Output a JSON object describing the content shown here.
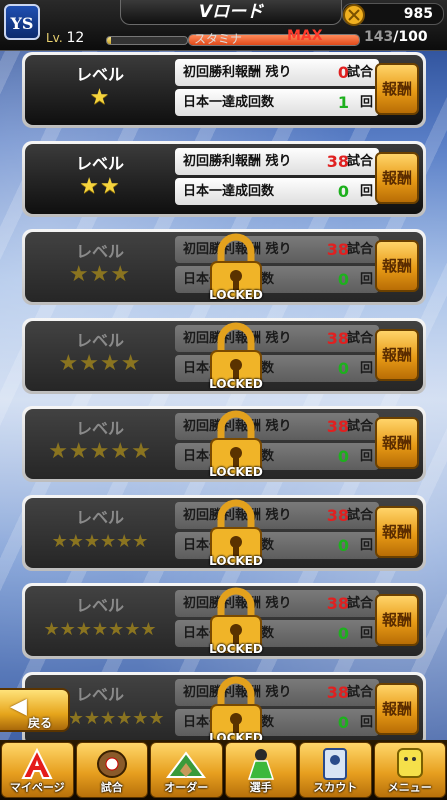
{
  "header": {
    "logo": "YS",
    "title": "Vロード",
    "coins": "985",
    "level_label": "Lv.",
    "level_value": "12",
    "exp_fraction": 0.05,
    "stamina_label": "スタミナ",
    "stamina_max_label": "MAX",
    "stamina_current": "143",
    "stamina_max": "/100",
    "stamina_fraction": 1.0
  },
  "rows": [
    {
      "level_label": "レベル",
      "stars": "★",
      "stars_count": 1,
      "first_win_label": "初回勝利報酬 残り",
      "first_win_value": "0",
      "first_win_unit": "試合",
      "champion_label": "日本一達成回数",
      "champion_value": "1",
      "champion_unit": "回",
      "reward_label": "報酬",
      "locked": false,
      "lock_label": ""
    },
    {
      "level_label": "レベル",
      "stars": "★★",
      "stars_count": 2,
      "first_win_label": "初回勝利報酬 残り",
      "first_win_value": "38",
      "first_win_unit": "試合",
      "champion_label": "日本一達成回数",
      "champion_value": "0",
      "champion_unit": "回",
      "reward_label": "報酬",
      "locked": false,
      "lock_label": ""
    },
    {
      "level_label": "レベル",
      "stars": "★★★",
      "stars_count": 3,
      "first_win_label": "初回勝利報酬 残り",
      "first_win_value": "38",
      "first_win_unit": "試合",
      "champion_label": "日本一達成回数",
      "champion_value": "0",
      "champion_unit": "回",
      "reward_label": "報酬",
      "locked": true,
      "lock_label": "LOCKED"
    },
    {
      "level_label": "レベル",
      "stars": "★★★★",
      "stars_count": 4,
      "first_win_label": "初回勝利報酬 残り",
      "first_win_value": "38",
      "first_win_unit": "試合",
      "champion_label": "日本一達成回数",
      "champion_value": "0",
      "champion_unit": "回",
      "reward_label": "報酬",
      "locked": true,
      "lock_label": "LOCKED"
    },
    {
      "level_label": "レベル",
      "stars": "★★★★★",
      "stars_count": 5,
      "first_win_label": "初回勝利報酬 残り",
      "first_win_value": "38",
      "first_win_unit": "試合",
      "champion_label": "日本一達成回数",
      "champion_value": "0",
      "champion_unit": "回",
      "reward_label": "報酬",
      "locked": true,
      "lock_label": "LOCKED"
    },
    {
      "level_label": "レベル",
      "stars": "★★★★★★",
      "stars_count": 6,
      "first_win_label": "初回勝利報酬 残り",
      "first_win_value": "38",
      "first_win_unit": "試合",
      "champion_label": "日本一達成回数",
      "champion_value": "0",
      "champion_unit": "回",
      "reward_label": "報酬",
      "locked": true,
      "lock_label": "LOCKED"
    },
    {
      "level_label": "レベル",
      "stars": "★★★★★★★",
      "stars_count": 7,
      "first_win_label": "初回勝利報酬 残り",
      "first_win_value": "38",
      "first_win_unit": "試合",
      "champion_label": "日本一達成回数",
      "champion_value": "0",
      "champion_unit": "回",
      "reward_label": "報酬",
      "locked": true,
      "lock_label": "LOCKED"
    },
    {
      "level_label": "レベル",
      "stars": "★★★★★★★★",
      "stars_count": 8,
      "first_win_label": "初回勝利報酬 残り",
      "first_win_value": "38",
      "first_win_unit": "試合",
      "champion_label": "日本一達成回数",
      "champion_value": "0",
      "champion_unit": "回",
      "reward_label": "報酬",
      "locked": true,
      "lock_label": "LOCKED"
    }
  ],
  "back_button": {
    "label": "戻る",
    "icon": "back-arrow-icon"
  },
  "bottom_nav": [
    {
      "label": "マイページ",
      "icon": "mypage-icon"
    },
    {
      "label": "試合",
      "icon": "baseball-glove-icon"
    },
    {
      "label": "オーダー",
      "icon": "diamond-field-icon"
    },
    {
      "label": "選手",
      "icon": "player-icon"
    },
    {
      "label": "スカウト",
      "icon": "scout-card-icon"
    },
    {
      "label": "メニュー",
      "icon": "menu-character-icon"
    }
  ],
  "colors": {
    "accent_gold": "#e7a020",
    "value_red": "#e02020",
    "value_green": "#1db01d",
    "max_red": "#ff3b2c"
  }
}
